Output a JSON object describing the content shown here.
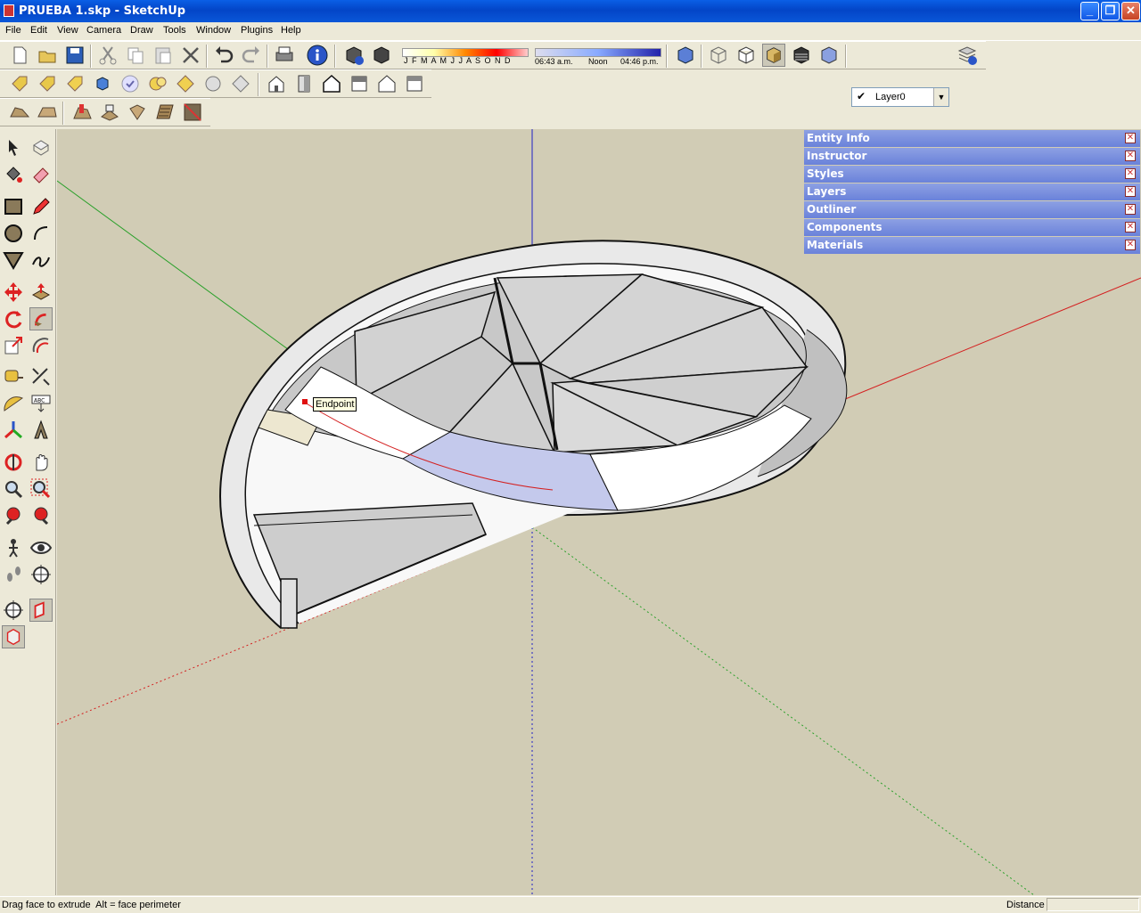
{
  "window": {
    "title": "PRUEBA 1.skp - SketchUp"
  },
  "menu": [
    "File",
    "Edit",
    "View",
    "Camera",
    "Draw",
    "Tools",
    "Window",
    "Plugins",
    "Help"
  ],
  "shadow": {
    "months": "J F M A M J J A S O N D",
    "time_start": "06:43 a.m.",
    "time_mid": "Noon",
    "time_end": "04:46 p.m."
  },
  "layer": {
    "name": "Layer0"
  },
  "trays": [
    "Entity Info",
    "Instructor",
    "Styles",
    "Layers",
    "Outliner",
    "Components",
    "Materials"
  ],
  "tooltip": "Endpoint",
  "status": {
    "hint": "Drag face to extrude  Alt = face perimeter",
    "measure_label": "Distance"
  }
}
